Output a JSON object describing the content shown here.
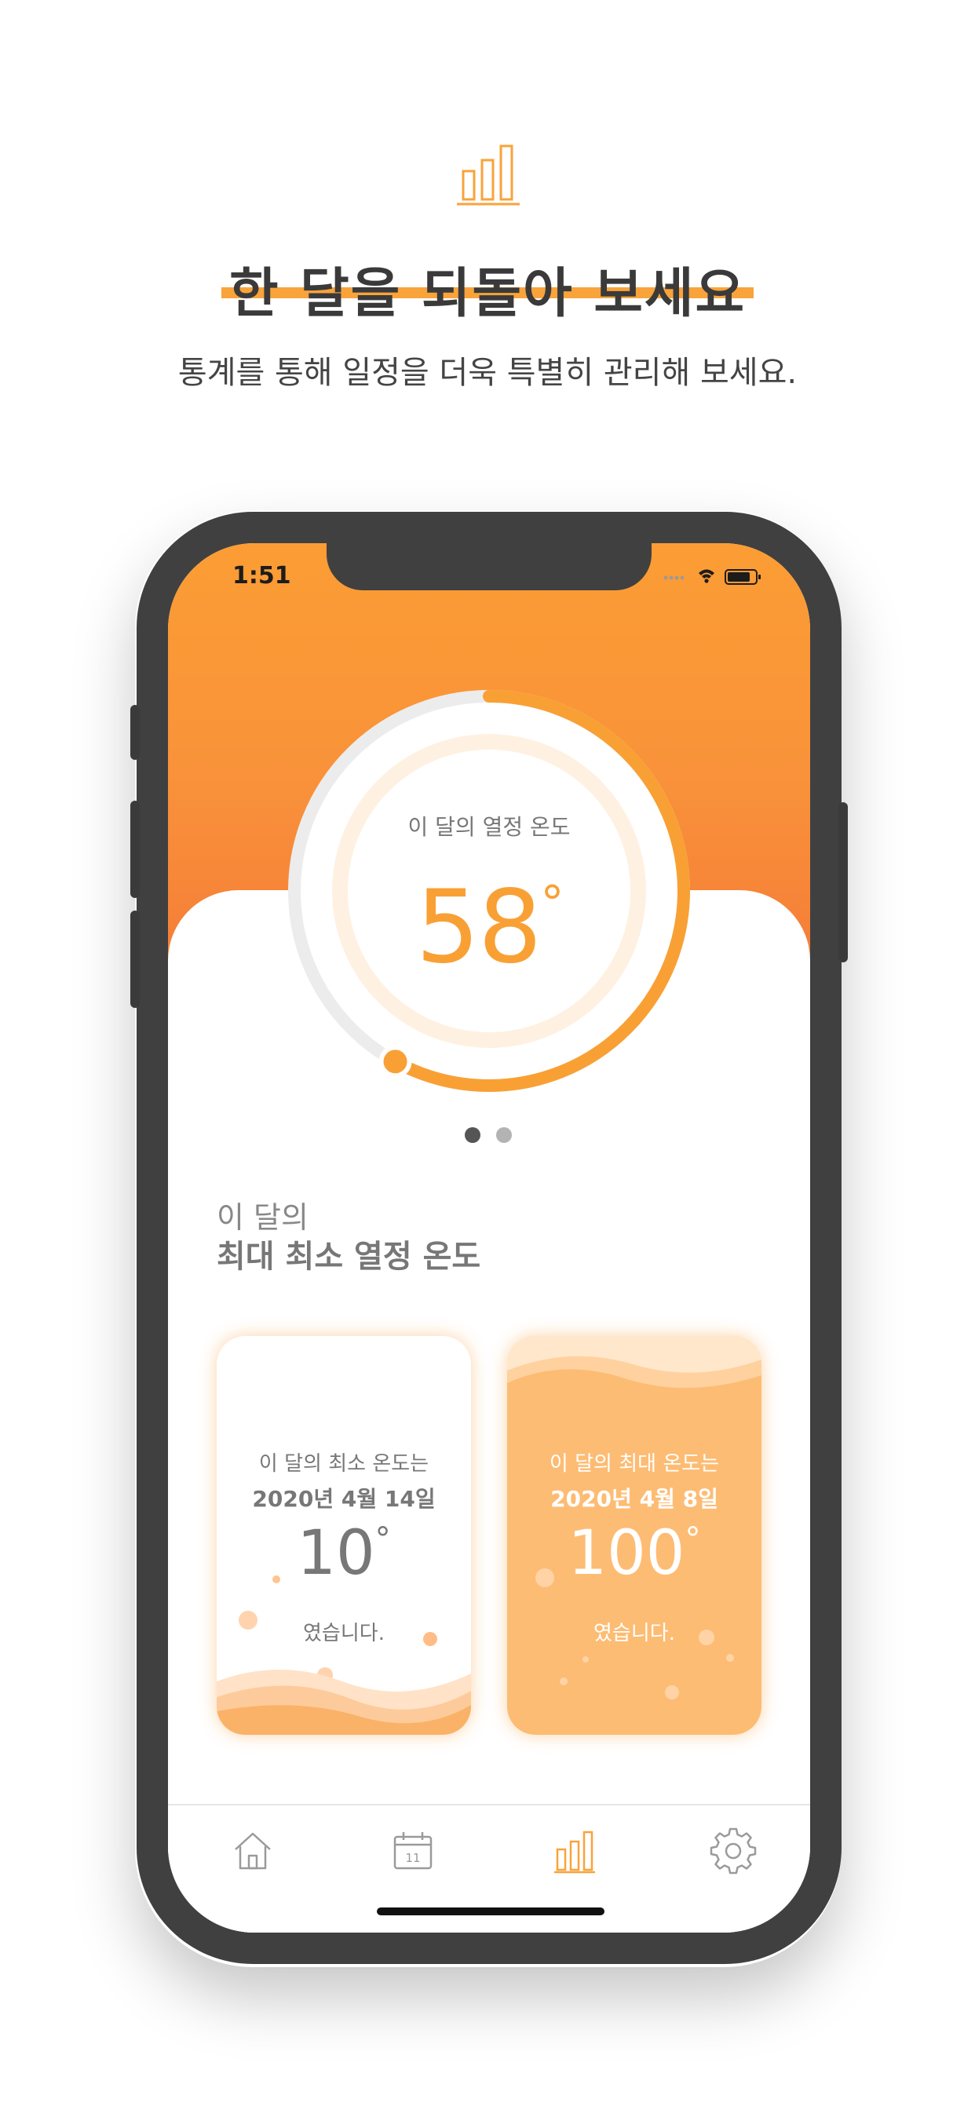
{
  "header": {
    "title": "한 달을 되돌아 보세요",
    "subtitle": "통계를 통해 일정을 더욱 특별히 관리해 보세요.",
    "icon": "bar-chart-icon",
    "accent_color": "#f9a33b"
  },
  "status_bar": {
    "time": "1:51",
    "icons": [
      "signal-icon",
      "wifi-icon",
      "battery-icon"
    ]
  },
  "gauge": {
    "label": "이 달의 열정 온도",
    "value": "58",
    "degree": "°",
    "percent": 58,
    "color": "#f9a035"
  },
  "pager": {
    "count": 2,
    "active": 0
  },
  "section": {
    "label": "이 달의",
    "title": "최대 최소 열정 온도"
  },
  "cards": {
    "min": {
      "line1": "이 달의 최소 온도는",
      "date": "2020년 4월 14일",
      "temp": "10",
      "degree": "°",
      "suffix": "였습니다."
    },
    "max": {
      "line1": "이 달의 최대 온도는",
      "date": "2020년 4월 8일",
      "temp": "100",
      "degree": "°",
      "suffix": "였습니다."
    }
  },
  "tabbar": {
    "items": [
      {
        "name": "home",
        "icon": "home-icon",
        "active": false
      },
      {
        "name": "calendar",
        "icon": "calendar-icon",
        "label": "11",
        "active": false
      },
      {
        "name": "stats",
        "icon": "bar-chart-icon",
        "active": true
      },
      {
        "name": "settings",
        "icon": "gear-icon",
        "active": false
      }
    ],
    "active_color": "#f9a33b",
    "inactive_color": "#9a9a9a"
  }
}
